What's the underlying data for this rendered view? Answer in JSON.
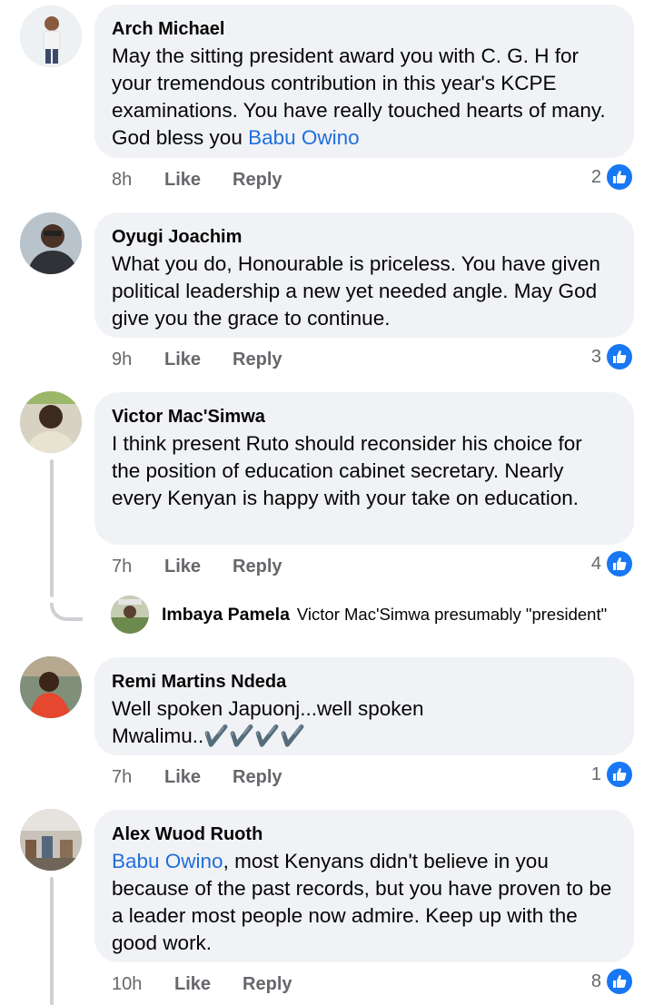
{
  "comments": [
    {
      "author": "Arch Michael",
      "text": "May the sitting president award you with C. G. H for your tremendous contribution in this year's KCPE examinations. You have really touched hearts of many. God bless you ",
      "mention": "Babu Owino",
      "time": "8h",
      "like_label": "Like",
      "reply_label": "Reply",
      "likes": "2"
    },
    {
      "author": "Oyugi Joachim",
      "text": "What you do, Honourable is priceless. You have given political leadership a new yet needed angle. May God give you the grace to continue.",
      "time": "9h",
      "like_label": "Like",
      "reply_label": "Reply",
      "likes": "3"
    },
    {
      "author": "Victor Mac'Simwa",
      "text": "I think present Ruto should reconsider his choice for the position of education cabinet secretary. Nearly every Kenyan is happy with your take on education.",
      "time": "7h",
      "like_label": "Like",
      "reply_label": "Reply",
      "likes": "4",
      "reply": {
        "author": "Imbaya Pamela",
        "text": "Victor Mac'Simwa presumably \"president\""
      }
    },
    {
      "author": "Remi Martins Ndeda",
      "text": "Well spoken Japuonj...well spoken Mwalimu..✔️✔️✔️✔️",
      "time": "7h",
      "like_label": "Like",
      "reply_label": "Reply",
      "likes": "1"
    },
    {
      "author": "Alex Wuod Ruoth",
      "mention": "Babu Owino",
      "text": ", most Kenyans didn't believe in you because of the past records, but you have proven to be a leader most people now admire. Keep up with the good work.",
      "time": "10h",
      "like_label": "Like",
      "reply_label": "Reply",
      "likes": "8"
    }
  ],
  "colors": {
    "bubble": "#f0f2f5",
    "mention": "#216fdb",
    "like_icon": "#1877f2",
    "meta_text": "#65676b"
  },
  "icons": {
    "reaction": "thumbs-up-icon"
  }
}
